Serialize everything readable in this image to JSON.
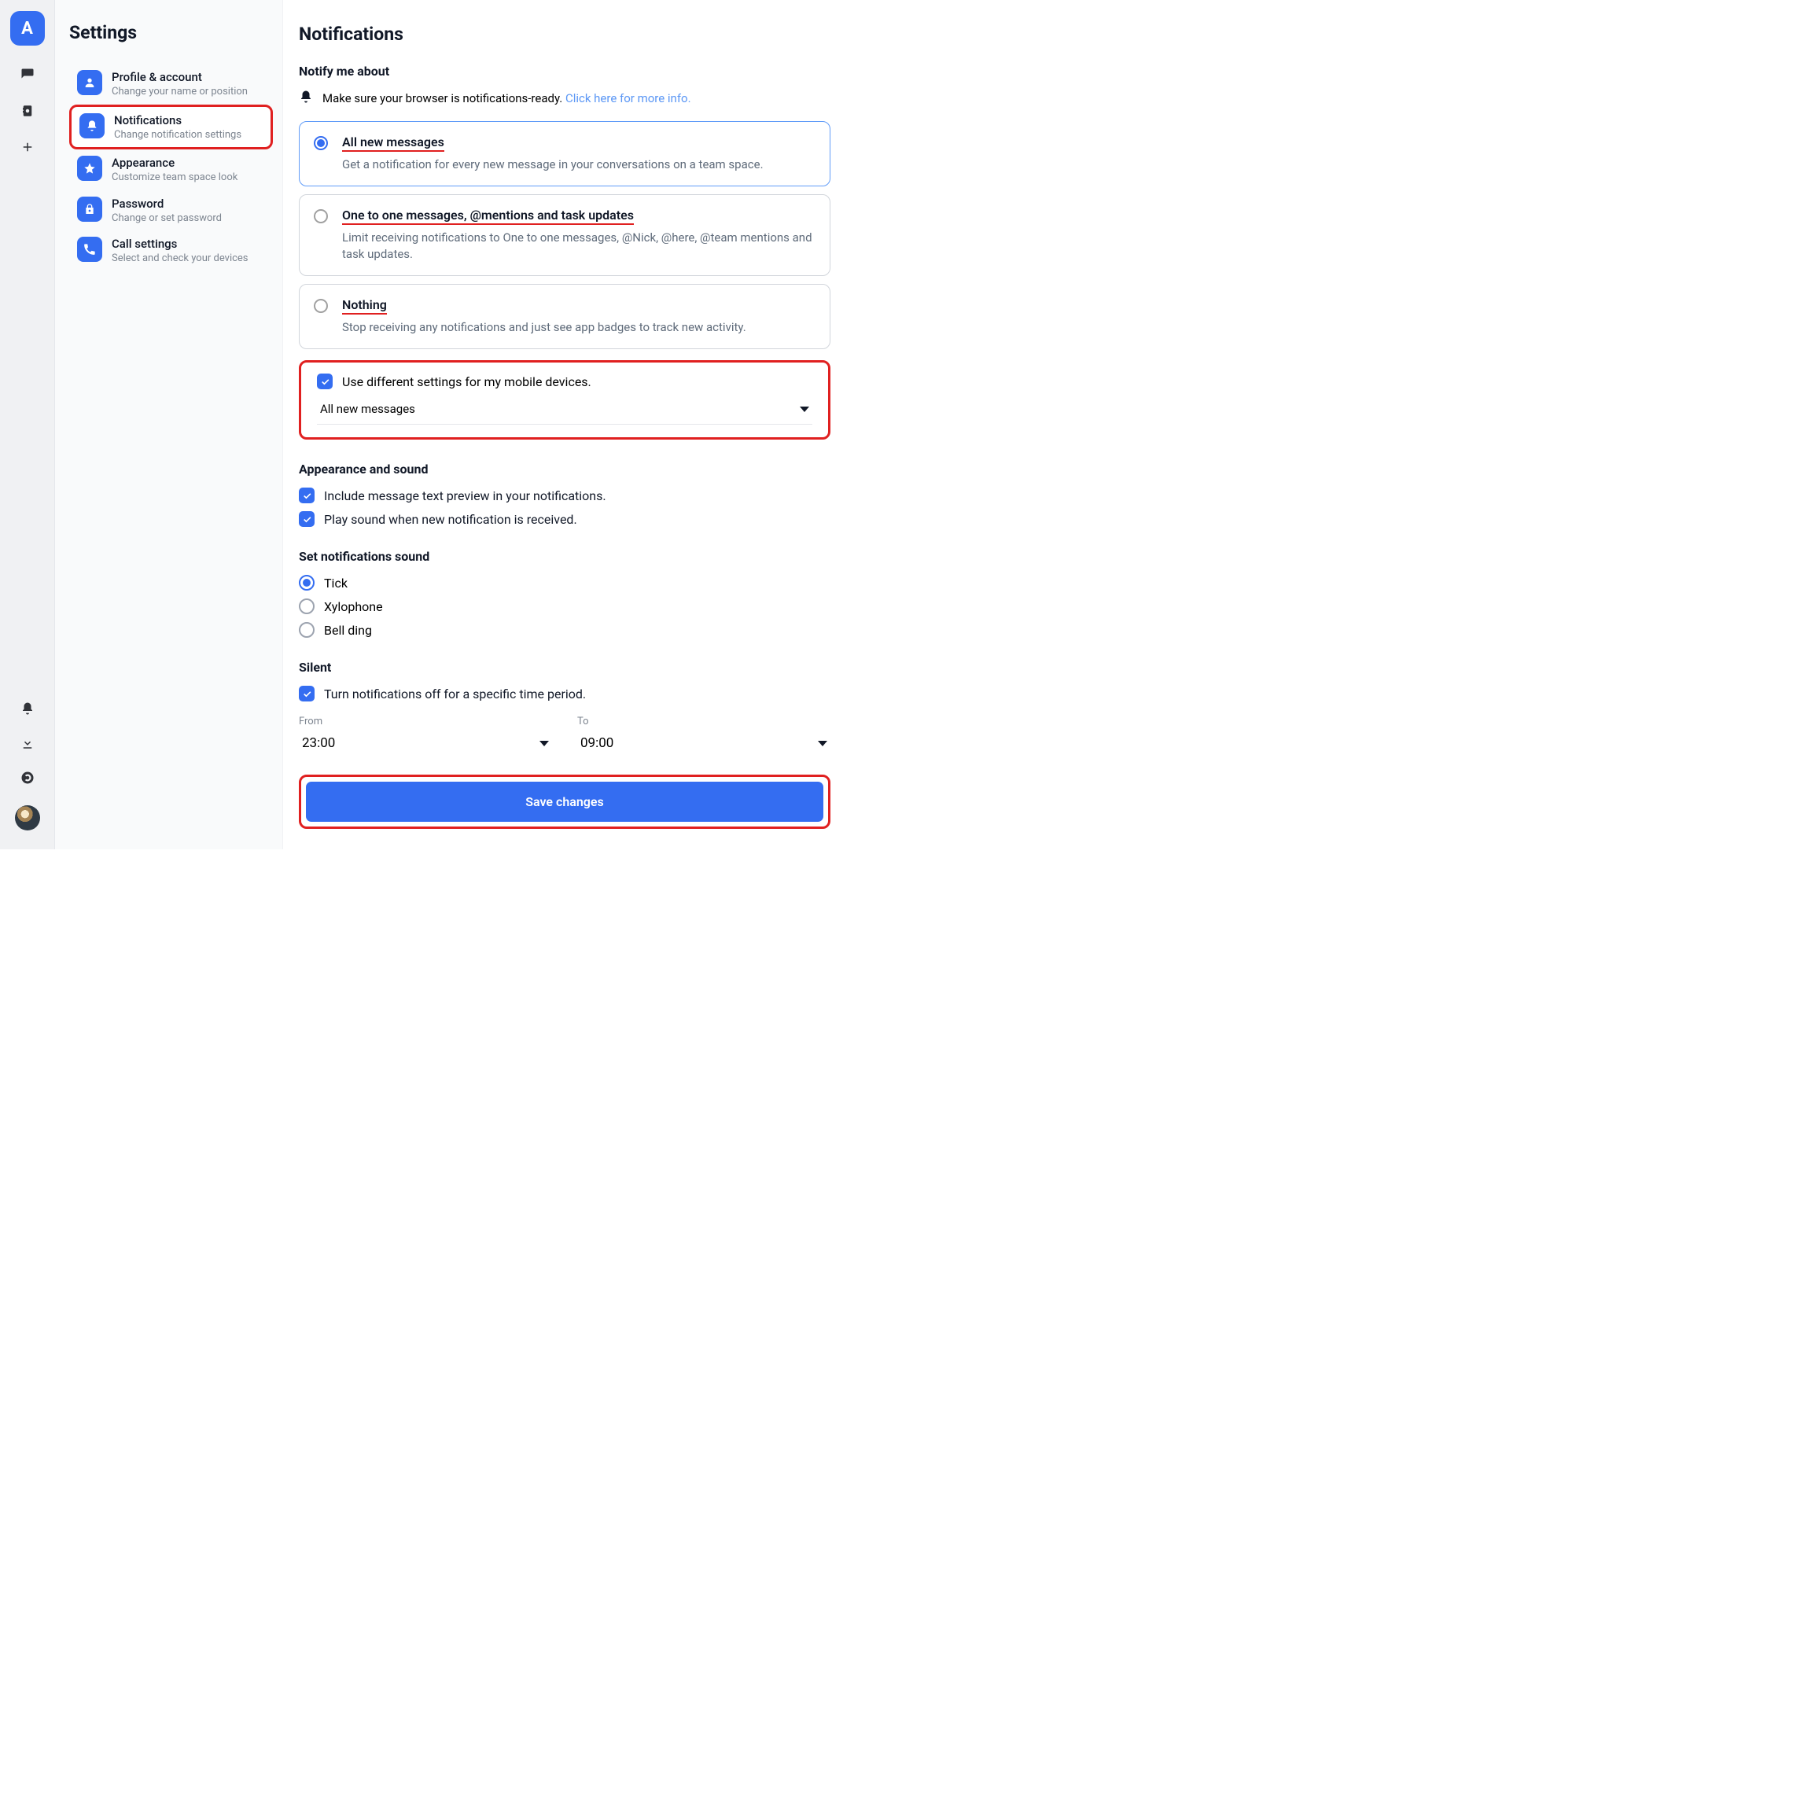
{
  "rail": {
    "logo_letter": "A"
  },
  "sidebar": {
    "title": "Settings",
    "items": [
      {
        "label": "Profile & account",
        "desc": "Change your name or position"
      },
      {
        "label": "Notifications",
        "desc": "Change notification settings"
      },
      {
        "label": "Appearance",
        "desc": "Customize team space look"
      },
      {
        "label": "Password",
        "desc": "Change or set password"
      },
      {
        "label": "Call settings",
        "desc": "Select and check your devices"
      }
    ]
  },
  "main": {
    "title": "Notifications",
    "notify_heading": "Notify me about",
    "info_text": "Make sure your browser is notifications-ready. ",
    "info_link": "Click here for more info.",
    "options": [
      {
        "title": "All new messages",
        "desc": "Get a notification for every new message in your conversations on a team space."
      },
      {
        "title": "One to one messages, @mentions and task updates",
        "desc": "Limit receiving notifications to One to one messages, @Nick, @here, @team mentions and task updates."
      },
      {
        "title": "Nothing",
        "desc": "Stop receiving any notifications and just see app badges to track new activity."
      }
    ],
    "mobile": {
      "check_label": "Use different settings for my mobile devices.",
      "selected": "All new messages"
    },
    "appearance_heading": "Appearance and sound",
    "preview_label": "Include message text preview in your notifications.",
    "play_sound_label": "Play sound when new notification is received.",
    "sound_heading": "Set notifications sound",
    "sounds": [
      "Tick",
      "Xylophone",
      "Bell ding"
    ],
    "silent_heading": "Silent",
    "silent_toggle": "Turn notifications off for a specific time period.",
    "from_label": "From",
    "from_value": "23:00",
    "to_label": "To",
    "to_value": "09:00",
    "save_label": "Save changes"
  }
}
